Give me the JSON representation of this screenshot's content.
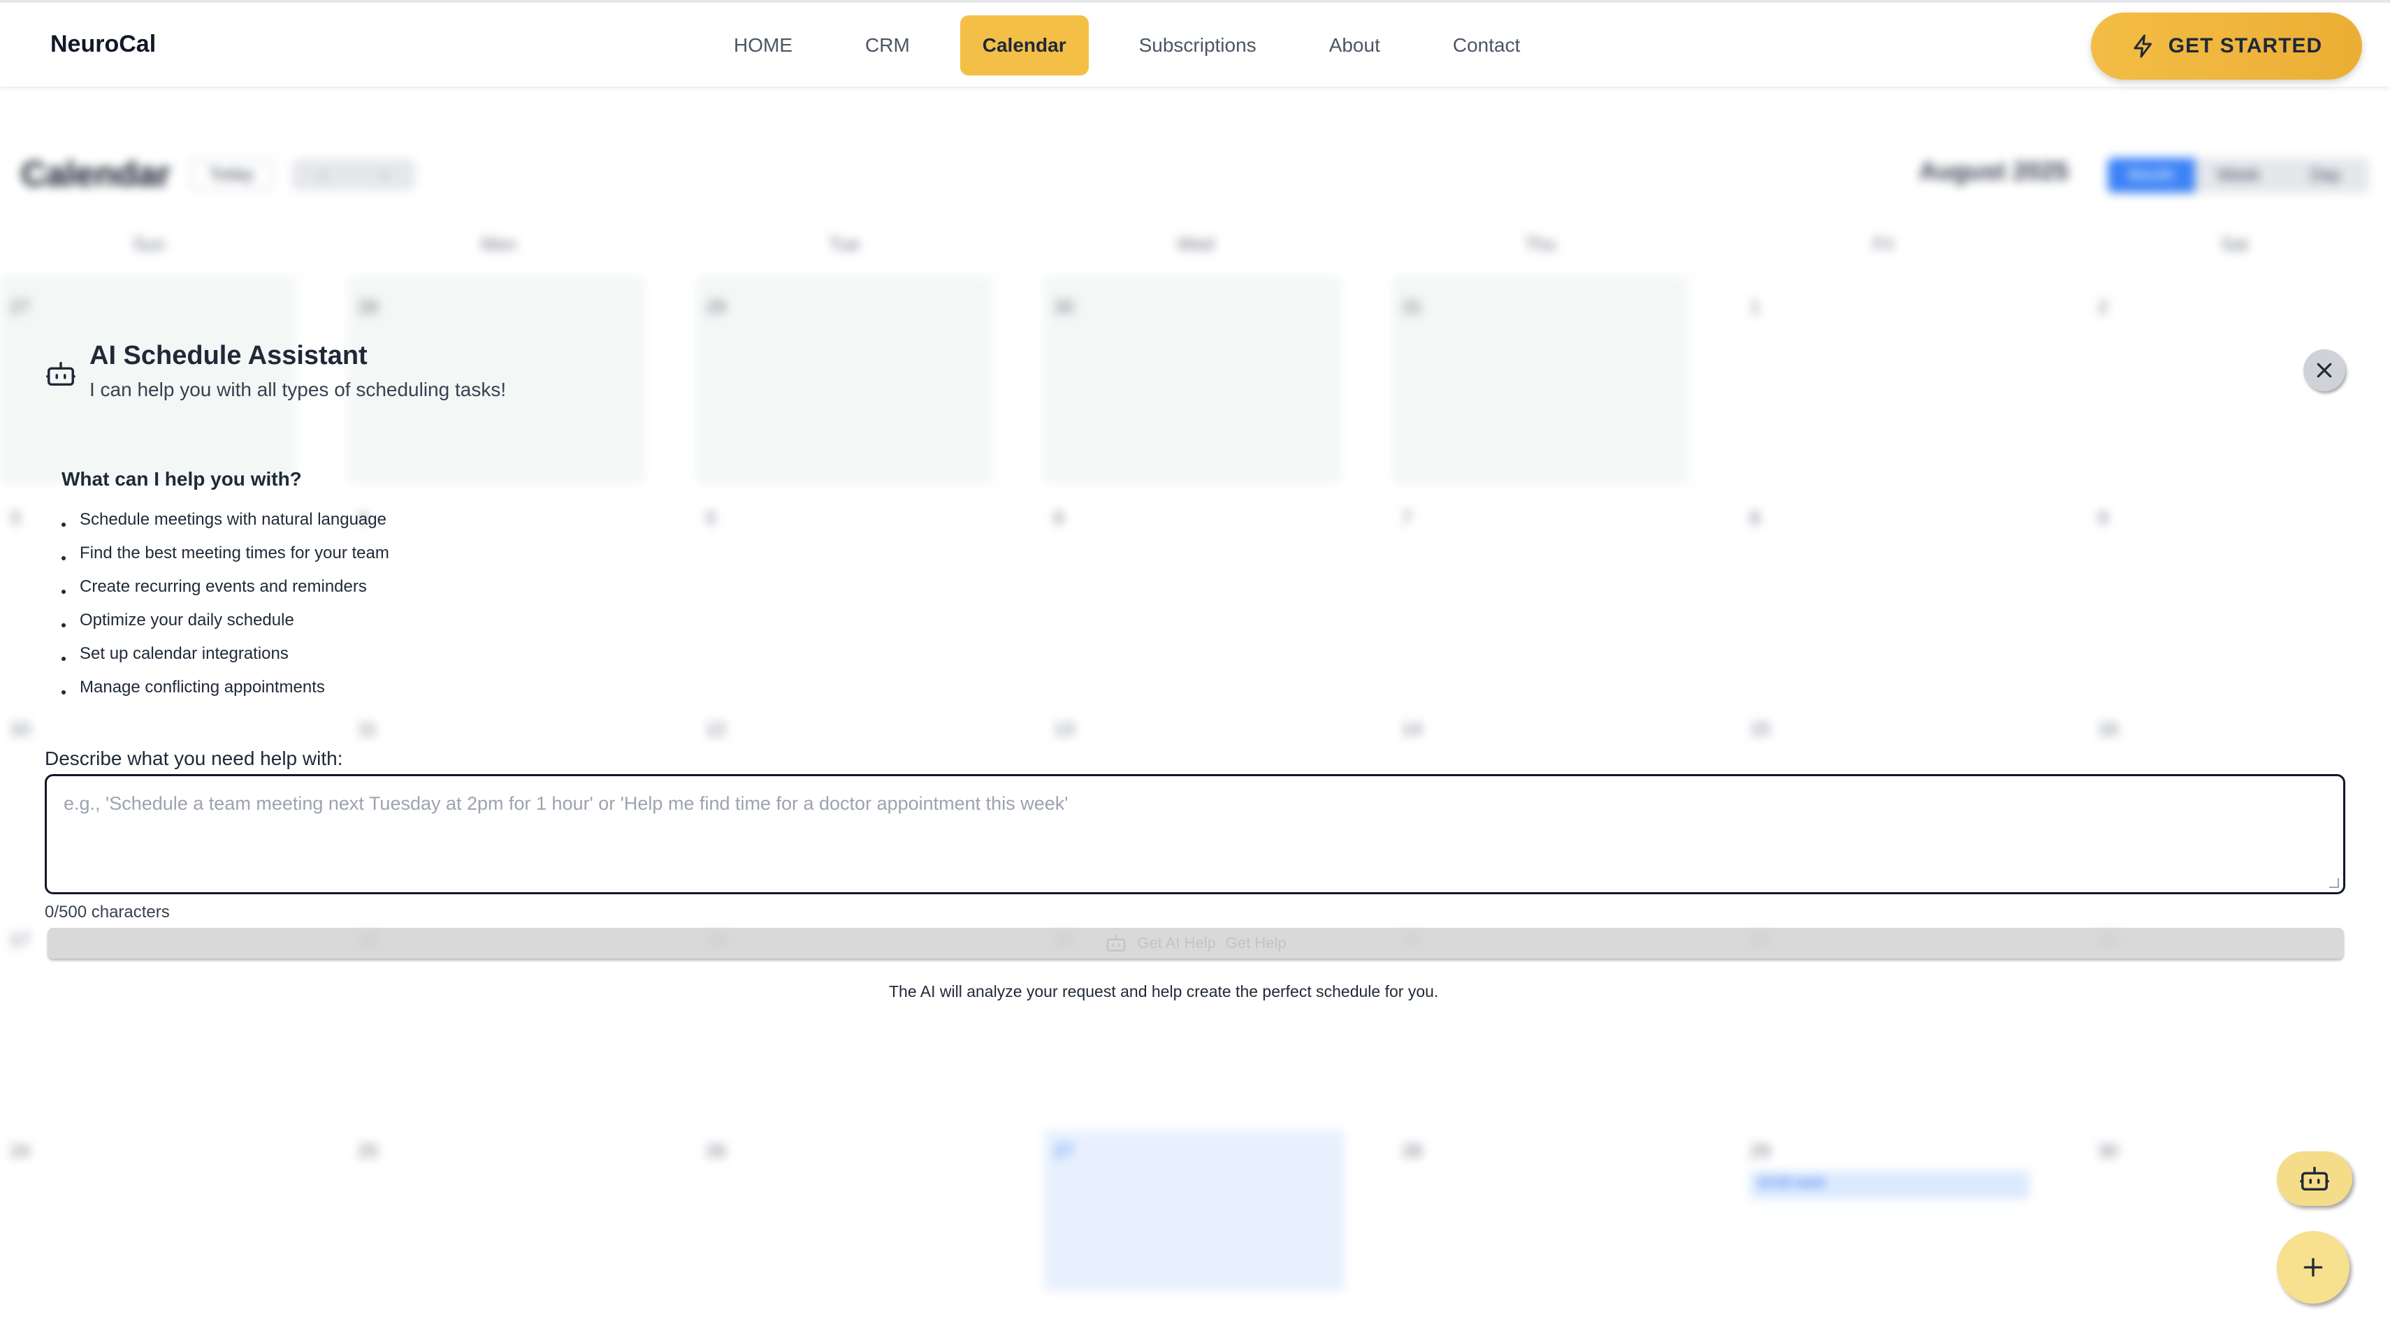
{
  "app": {
    "brand": "NeuroCal"
  },
  "nav": {
    "items": [
      {
        "label": "HOME"
      },
      {
        "label": "CRM"
      },
      {
        "label": "Calendar",
        "active": true
      },
      {
        "label": "Subscriptions"
      },
      {
        "label": "About"
      },
      {
        "label": "Contact"
      }
    ],
    "cta_label": "GET STARTED",
    "cta_icon": "lightning-icon"
  },
  "calendar": {
    "title": "Calendar",
    "today_label": "Today",
    "month_label": "August 2025",
    "views": [
      "Month",
      "Week",
      "Day"
    ],
    "active_view": "Month",
    "weekdays": [
      "Sun",
      "Mon",
      "Tue",
      "Wed",
      "Thu",
      "Fri",
      "Sat"
    ],
    "weeks": [
      [
        "27",
        "28",
        "29",
        "30",
        "31",
        "1",
        "2"
      ],
      [
        "3",
        "4",
        "5",
        "6",
        "7",
        "8",
        "9"
      ],
      [
        "10",
        "11",
        "12",
        "13",
        "14",
        "15",
        "16"
      ],
      [
        "17",
        "18",
        "19",
        "20",
        "21",
        "22",
        "23"
      ],
      [
        "24",
        "25",
        "26",
        "27",
        "28",
        "29",
        "30"
      ]
    ],
    "today_day": "27",
    "event_label": "10:00 work"
  },
  "assistant": {
    "title": "AI Schedule Assistant",
    "subtitle": "I can help you with all types of scheduling tasks!",
    "help_heading": "What can I help you with?",
    "help_items": [
      "Schedule meetings with natural language",
      "Find the best meeting times for your team",
      "Create recurring events and reminders",
      "Optimize your daily schedule",
      "Set up calendar integrations",
      "Manage conflicting appointments"
    ],
    "prompt_label": "Describe what you need help with:",
    "prompt_placeholder": "e.g., 'Schedule a team meeting next Tuesday at 2pm for 1 hour' or 'Help me find time for a doctor appointment this week'",
    "prompt_value": "",
    "char_count": "0/500 characters",
    "submit_label": "Get AI Help",
    "submit_label_alt": "Get Help",
    "disclaimer": "The AI will analyze your request and help create the perfect schedule for you."
  },
  "colors": {
    "accent": "#f4bf47",
    "primary_blue": "#3b82f6"
  }
}
